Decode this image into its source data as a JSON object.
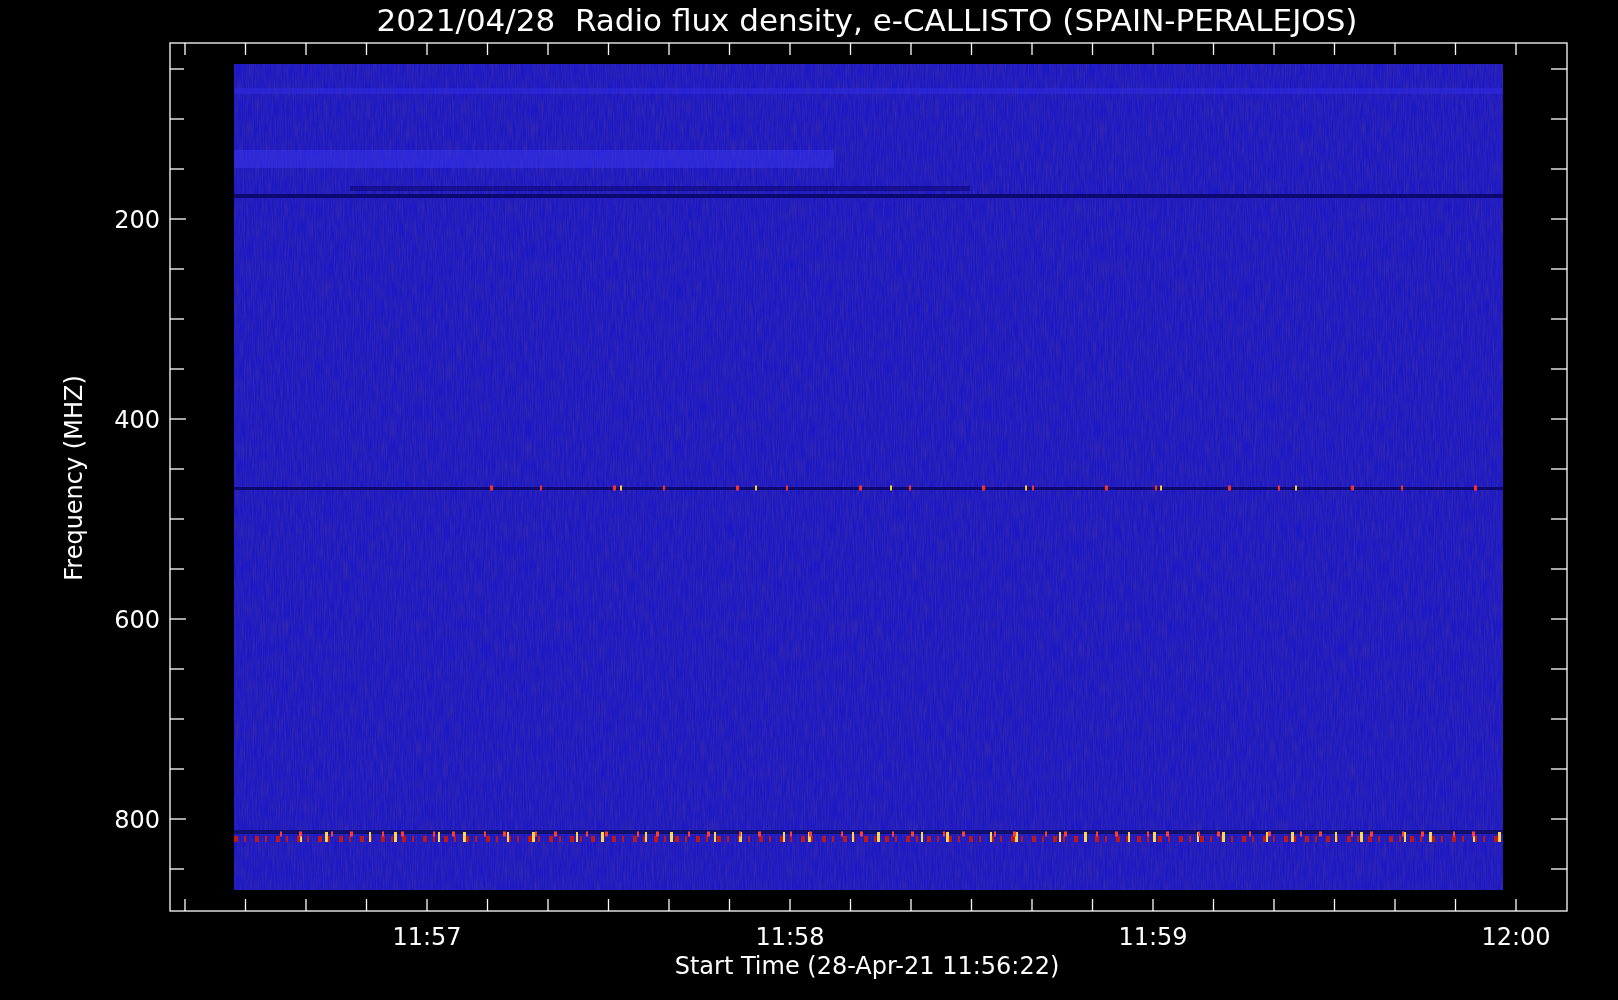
{
  "title": "2021/04/28  Radio flux density, e-CALLISTO (SPAIN-PERALEJOS)",
  "y_axis": {
    "label": "Frequency (MHZ)",
    "ticks": [
      "200",
      "400",
      "600",
      "800"
    ]
  },
  "x_axis": {
    "label": "Start Time (28-Apr-21 11:56:22)",
    "ticks": [
      "11:57",
      "11:58",
      "11:59",
      "12:00"
    ]
  }
}
